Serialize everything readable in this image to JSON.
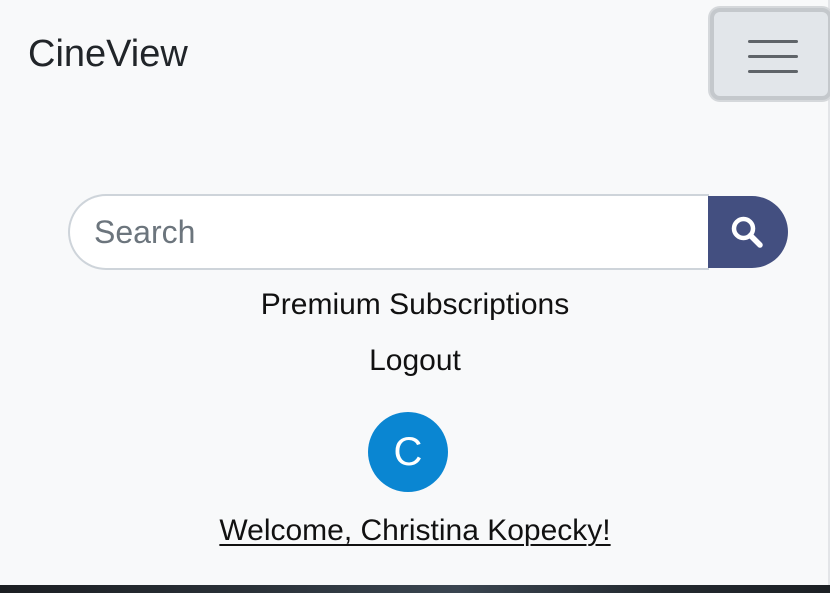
{
  "navbar": {
    "brand": "CineView",
    "toggler_icon": "hamburger-menu-icon"
  },
  "search": {
    "placeholder": "Search",
    "value": "",
    "button_icon": "search-icon",
    "button_color": "#434f80"
  },
  "menu": {
    "items": [
      {
        "label": "Premium Subscriptions"
      },
      {
        "label": "Logout"
      }
    ]
  },
  "user": {
    "avatar_initial": "C",
    "avatar_color": "#0a86d2",
    "welcome": "Welcome, Christina Kopecky!"
  }
}
